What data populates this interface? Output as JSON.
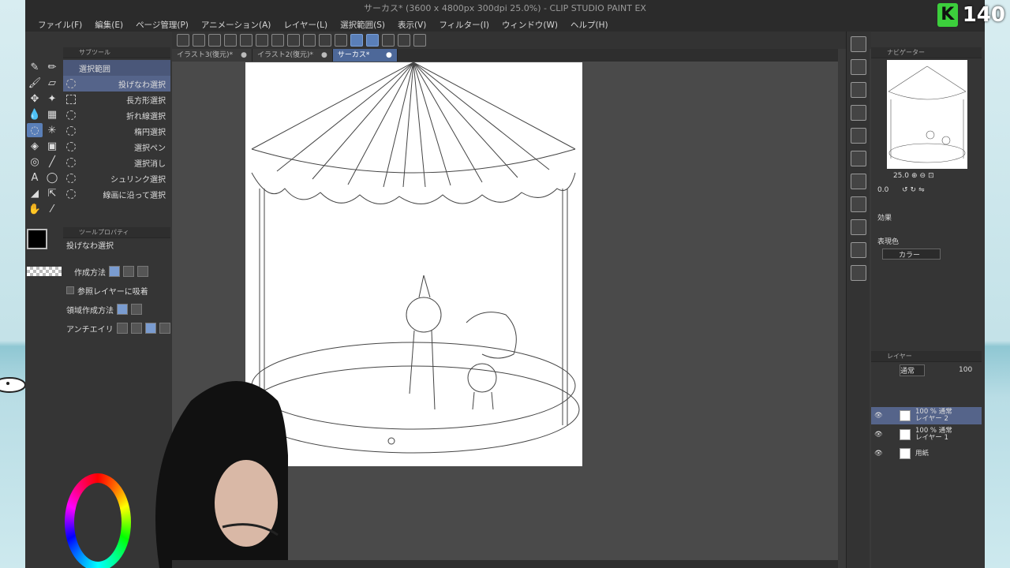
{
  "overlay": {
    "badge_letter": "K",
    "badge_number": "140"
  },
  "window": {
    "title": "サーカス* (3600 x 4800px 300dpi 25.0%) - CLIP STUDIO PAINT EX"
  },
  "menu": [
    "ファイル(F)",
    "編集(E)",
    "ページ管理(P)",
    "アニメーション(A)",
    "レイヤー(L)",
    "選択範囲(S)",
    "表示(V)",
    "フィルター(I)",
    "ウィンドウ(W)",
    "ヘルプ(H)"
  ],
  "tabs": [
    {
      "label": "イラスト3(復元)*"
    },
    {
      "label": "イラスト2(復元)*"
    },
    {
      "label": "サーカス*"
    }
  ],
  "subtool": {
    "header": "サブツール",
    "group": "選択範囲",
    "items": [
      "投げなわ選択",
      "長方形選択",
      "折れ線選択",
      "楕円選択",
      "選択ペン",
      "選択消し",
      "シュリンク選択",
      "線画に沿って選択"
    ]
  },
  "toolprop": {
    "header": "ツールプロパティ",
    "tool": "投げなわ選択",
    "rows": [
      "作成方法",
      "参照レイヤーに吸着",
      "領域作成方法",
      "アンチエイリ"
    ]
  },
  "navigator": {
    "header": "ナビゲーター",
    "zoom": "25.0",
    "angle": "0.0"
  },
  "effects": {
    "title": "効果",
    "color_label": "表現色",
    "color_value": "カラー"
  },
  "layers": {
    "header": "レイヤー",
    "blend": "通常",
    "opacity": "100",
    "items": [
      {
        "l1": "100 % 通常",
        "l2": "レイヤー 2"
      },
      {
        "l1": "100 % 通常",
        "l2": "レイヤー 1"
      },
      {
        "l1": "用紙",
        "l2": ""
      }
    ]
  },
  "colors": {
    "accent": "#5a7fb8",
    "selected": "#55648a",
    "panel": "#353535",
    "badge": "#3ccf3c"
  }
}
